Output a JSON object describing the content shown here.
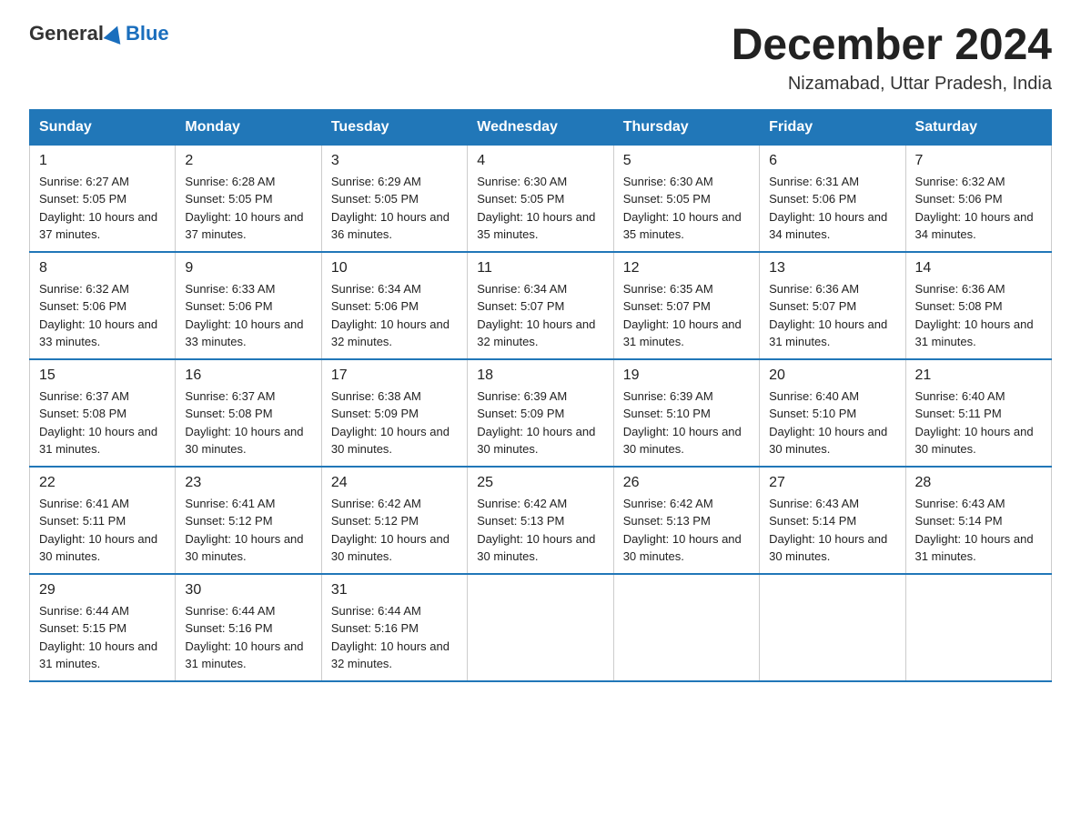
{
  "logo": {
    "text_general": "General",
    "text_blue": "Blue"
  },
  "title": "December 2024",
  "subtitle": "Nizamabad, Uttar Pradesh, India",
  "days_of_week": [
    "Sunday",
    "Monday",
    "Tuesday",
    "Wednesday",
    "Thursday",
    "Friday",
    "Saturday"
  ],
  "weeks": [
    [
      {
        "day": "1",
        "sunrise": "6:27 AM",
        "sunset": "5:05 PM",
        "daylight": "10 hours and 37 minutes."
      },
      {
        "day": "2",
        "sunrise": "6:28 AM",
        "sunset": "5:05 PM",
        "daylight": "10 hours and 37 minutes."
      },
      {
        "day": "3",
        "sunrise": "6:29 AM",
        "sunset": "5:05 PM",
        "daylight": "10 hours and 36 minutes."
      },
      {
        "day": "4",
        "sunrise": "6:30 AM",
        "sunset": "5:05 PM",
        "daylight": "10 hours and 35 minutes."
      },
      {
        "day": "5",
        "sunrise": "6:30 AM",
        "sunset": "5:05 PM",
        "daylight": "10 hours and 35 minutes."
      },
      {
        "day": "6",
        "sunrise": "6:31 AM",
        "sunset": "5:06 PM",
        "daylight": "10 hours and 34 minutes."
      },
      {
        "day": "7",
        "sunrise": "6:32 AM",
        "sunset": "5:06 PM",
        "daylight": "10 hours and 34 minutes."
      }
    ],
    [
      {
        "day": "8",
        "sunrise": "6:32 AM",
        "sunset": "5:06 PM",
        "daylight": "10 hours and 33 minutes."
      },
      {
        "day": "9",
        "sunrise": "6:33 AM",
        "sunset": "5:06 PM",
        "daylight": "10 hours and 33 minutes."
      },
      {
        "day": "10",
        "sunrise": "6:34 AM",
        "sunset": "5:06 PM",
        "daylight": "10 hours and 32 minutes."
      },
      {
        "day": "11",
        "sunrise": "6:34 AM",
        "sunset": "5:07 PM",
        "daylight": "10 hours and 32 minutes."
      },
      {
        "day": "12",
        "sunrise": "6:35 AM",
        "sunset": "5:07 PM",
        "daylight": "10 hours and 31 minutes."
      },
      {
        "day": "13",
        "sunrise": "6:36 AM",
        "sunset": "5:07 PM",
        "daylight": "10 hours and 31 minutes."
      },
      {
        "day": "14",
        "sunrise": "6:36 AM",
        "sunset": "5:08 PM",
        "daylight": "10 hours and 31 minutes."
      }
    ],
    [
      {
        "day": "15",
        "sunrise": "6:37 AM",
        "sunset": "5:08 PM",
        "daylight": "10 hours and 31 minutes."
      },
      {
        "day": "16",
        "sunrise": "6:37 AM",
        "sunset": "5:08 PM",
        "daylight": "10 hours and 30 minutes."
      },
      {
        "day": "17",
        "sunrise": "6:38 AM",
        "sunset": "5:09 PM",
        "daylight": "10 hours and 30 minutes."
      },
      {
        "day": "18",
        "sunrise": "6:39 AM",
        "sunset": "5:09 PM",
        "daylight": "10 hours and 30 minutes."
      },
      {
        "day": "19",
        "sunrise": "6:39 AM",
        "sunset": "5:10 PM",
        "daylight": "10 hours and 30 minutes."
      },
      {
        "day": "20",
        "sunrise": "6:40 AM",
        "sunset": "5:10 PM",
        "daylight": "10 hours and 30 minutes."
      },
      {
        "day": "21",
        "sunrise": "6:40 AM",
        "sunset": "5:11 PM",
        "daylight": "10 hours and 30 minutes."
      }
    ],
    [
      {
        "day": "22",
        "sunrise": "6:41 AM",
        "sunset": "5:11 PM",
        "daylight": "10 hours and 30 minutes."
      },
      {
        "day": "23",
        "sunrise": "6:41 AM",
        "sunset": "5:12 PM",
        "daylight": "10 hours and 30 minutes."
      },
      {
        "day": "24",
        "sunrise": "6:42 AM",
        "sunset": "5:12 PM",
        "daylight": "10 hours and 30 minutes."
      },
      {
        "day": "25",
        "sunrise": "6:42 AM",
        "sunset": "5:13 PM",
        "daylight": "10 hours and 30 minutes."
      },
      {
        "day": "26",
        "sunrise": "6:42 AM",
        "sunset": "5:13 PM",
        "daylight": "10 hours and 30 minutes."
      },
      {
        "day": "27",
        "sunrise": "6:43 AM",
        "sunset": "5:14 PM",
        "daylight": "10 hours and 30 minutes."
      },
      {
        "day": "28",
        "sunrise": "6:43 AM",
        "sunset": "5:14 PM",
        "daylight": "10 hours and 31 minutes."
      }
    ],
    [
      {
        "day": "29",
        "sunrise": "6:44 AM",
        "sunset": "5:15 PM",
        "daylight": "10 hours and 31 minutes."
      },
      {
        "day": "30",
        "sunrise": "6:44 AM",
        "sunset": "5:16 PM",
        "daylight": "10 hours and 31 minutes."
      },
      {
        "day": "31",
        "sunrise": "6:44 AM",
        "sunset": "5:16 PM",
        "daylight": "10 hours and 32 minutes."
      },
      null,
      null,
      null,
      null
    ]
  ],
  "labels": {
    "sunrise_prefix": "Sunrise: ",
    "sunset_prefix": "Sunset: ",
    "daylight_prefix": "Daylight: "
  }
}
